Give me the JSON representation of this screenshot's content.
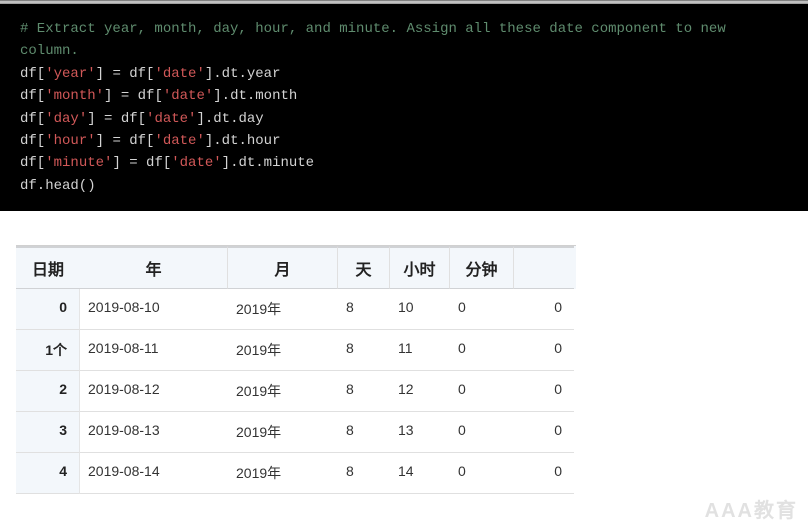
{
  "code": {
    "comment": "# Extract year, month, day, hour, and minute. Assign all these date component to new column.",
    "l1a": "df[",
    "l1b": "'year'",
    "l1c": "] = df[",
    "l1d": "'date'",
    "l1e": "].dt.year",
    "l2a": "df[",
    "l2b": "'month'",
    "l2c": "] = df[",
    "l2d": "'date'",
    "l2e": "].dt.month",
    "l3a": "df[",
    "l3b": "'day'",
    "l3c": "] = df[",
    "l3d": "'date'",
    "l3e": "].dt.day",
    "l4a": "df[",
    "l4b": "'hour'",
    "l4c": "] = df[",
    "l4d": "'date'",
    "l4e": "].dt.hour",
    "l5a": "df[",
    "l5b": "'minute'",
    "l5c": "] = df[",
    "l5d": "'date'",
    "l5e": "].dt.minute",
    "l6": "df.head()"
  },
  "table": {
    "headers": {
      "idx": "日期",
      "year": "年",
      "month": "月",
      "day": "天",
      "hour": "小时",
      "minute": "分钟"
    },
    "rows": [
      {
        "idx": "0",
        "date": "2019-08-10",
        "year": "2019年",
        "month": "8",
        "day": "10",
        "hour": "0",
        "minute": "0"
      },
      {
        "idx": "1个",
        "date": "2019-08-11",
        "year": "2019年",
        "month": "8",
        "day": "11",
        "hour": "0",
        "minute": "0"
      },
      {
        "idx": "2",
        "date": "2019-08-12",
        "year": "2019年",
        "month": "8",
        "day": "12",
        "hour": "0",
        "minute": "0"
      },
      {
        "idx": "3",
        "date": "2019-08-13",
        "year": "2019年",
        "month": "8",
        "day": "13",
        "hour": "0",
        "minute": "0"
      },
      {
        "idx": "4",
        "date": "2019-08-14",
        "year": "2019年",
        "month": "8",
        "day": "14",
        "hour": "0",
        "minute": "0"
      }
    ]
  },
  "watermark": "AAA教育"
}
